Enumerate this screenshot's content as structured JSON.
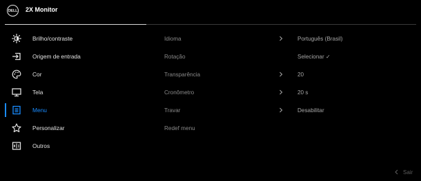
{
  "header": {
    "logo_text": "DELL",
    "title": "2X Monitor"
  },
  "menu": {
    "items": [
      {
        "label": "Brilho/contraste",
        "icon": "brightness-icon"
      },
      {
        "label": "Origem de entrada",
        "icon": "input-source-icon"
      },
      {
        "label": "Cor",
        "icon": "color-palette-icon"
      },
      {
        "label": "Tela",
        "icon": "display-icon"
      },
      {
        "label": "Menu",
        "icon": "menu-icon",
        "active": true
      },
      {
        "label": "Personalizar",
        "icon": "star-icon"
      },
      {
        "label": "Outros",
        "icon": "others-icon"
      }
    ]
  },
  "submenu": {
    "rows": [
      {
        "label": "Idioma",
        "has_arrow": true,
        "value": "Português (Brasil)"
      },
      {
        "label": "Rotação",
        "has_arrow": false,
        "value": "Selecionar ✓"
      },
      {
        "label": "Transparência",
        "has_arrow": true,
        "value": "20"
      },
      {
        "label": "Cronômetro",
        "has_arrow": true,
        "value": "20 s"
      },
      {
        "label": "Travar",
        "has_arrow": true,
        "value": "Desabilitar"
      },
      {
        "label": "Redef menu",
        "has_arrow": false,
        "value": ""
      }
    ]
  },
  "footer": {
    "exit_label": "Sair"
  },
  "colors": {
    "accent": "#1a8cff",
    "background": "#000000",
    "text": "#e2e2e2",
    "muted": "#8a8a8a"
  }
}
